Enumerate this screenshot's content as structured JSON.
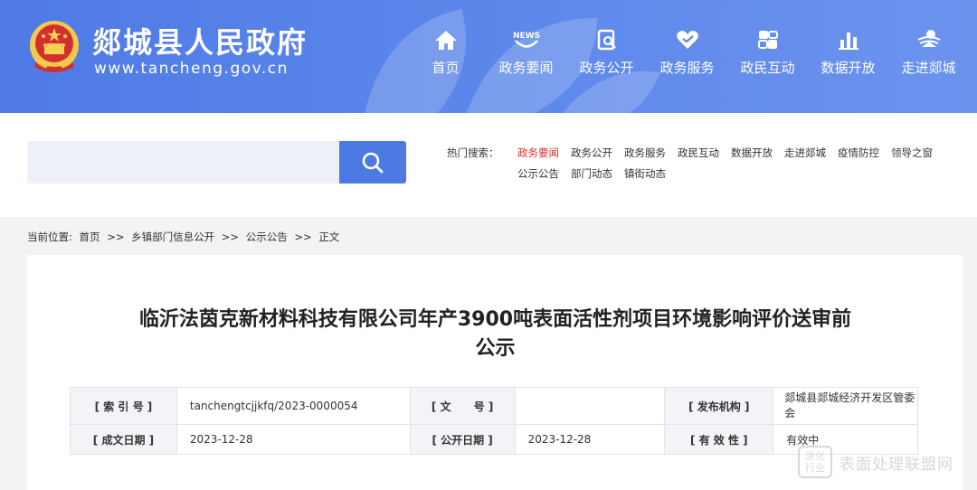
{
  "header": {
    "site_title": "郯城县人民政府",
    "site_url": "www.tancheng.gov.cn",
    "nav": [
      {
        "label": "首页",
        "icon": "home-icon"
      },
      {
        "label": "政务要闻",
        "icon": "news-icon"
      },
      {
        "label": "政务公开",
        "icon": "public-info-icon"
      },
      {
        "label": "政务服务",
        "icon": "service-heart-icon"
      },
      {
        "label": "政民互动",
        "icon": "interaction-icon"
      },
      {
        "label": "数据开放",
        "icon": "data-chart-icon"
      },
      {
        "label": "走进郯城",
        "icon": "city-icon"
      }
    ],
    "colors": {
      "bg_start": "#4f7ae6",
      "bg_end": "#6b93ee"
    }
  },
  "search": {
    "placeholder": "",
    "button_icon": "search-icon",
    "hot_label": "热门搜索：",
    "hot_row1": [
      "政务要闻",
      "政务公开",
      "政务服务",
      "政民互动",
      "数据开放",
      "走进郯城",
      "疫情防控",
      "领导之窗"
    ],
    "hot_row2": [
      "公示公告",
      "部门动态",
      "镇街动态"
    ],
    "active_color": "#d9322e"
  },
  "breadcrumb": {
    "prefix": "当前位置:",
    "items": [
      "首页",
      "乡镇部门信息公开",
      "公示公告",
      "正文"
    ],
    "separator": ">>"
  },
  "article": {
    "title_line1": "临沂法茵克新材料科技有限公司年产3900吨表面活性剂项目环境影响评价送审前",
    "title_line2": "公示",
    "meta": {
      "index_label": "[ 索 引 号 ]",
      "index_value": "tanchengtcjjkfq/2023-0000054",
      "doc_label": "[ 文      号 ]",
      "doc_value": "",
      "publisher_label": "[ 发布机构 ]",
      "publisher_value": "郯城县郯城经济开发区管委会",
      "created_label": "[ 成文日期 ]",
      "created_value": "2023-12-28",
      "opened_label": "[ 公开日期 ]",
      "opened_value": "2023-12-28",
      "validity_label": "[ 有 效 性 ]",
      "validity_value": "有效中"
    }
  },
  "watermark": {
    "box_text": "涂化行业",
    "text": "表面处理联盟网"
  }
}
